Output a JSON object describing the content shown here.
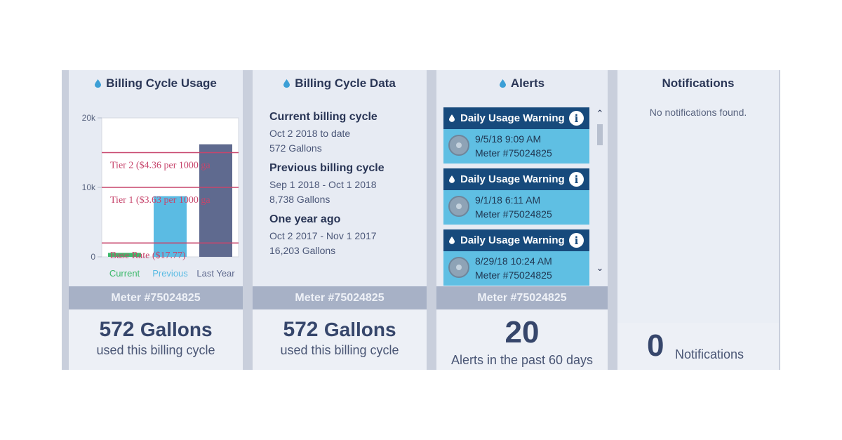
{
  "usage_panel": {
    "title": "Billing Cycle Usage",
    "meter_label": "Meter #75024825",
    "gallons_value": "572",
    "gallons_unit": "Gallons",
    "gallons_caption": "used this billing cycle"
  },
  "chart_data": {
    "type": "bar",
    "categories": [
      "Current",
      "Previous",
      "Last Year"
    ],
    "values": [
      572,
      8738,
      16203
    ],
    "category_colors": [
      "#3cb96a",
      "#5bbbe3",
      "#5f6a8f"
    ],
    "ylim": [
      0,
      20000
    ],
    "ytick_labels": [
      "20k",
      "10k",
      "0"
    ],
    "ytick_values": [
      20000,
      10000,
      0
    ],
    "rate_lines": [
      {
        "label": "Tier 2 ($4.36 per 1000 ga",
        "value": 15000
      },
      {
        "label": "Tier 1 ($3.63 per 1000 ga",
        "value": 10000
      },
      {
        "label": "Base Rate ($17.77)",
        "value": 2000
      }
    ],
    "rate_color": "#c7456c"
  },
  "data_panel": {
    "title": "Billing Cycle Data",
    "blocks": [
      {
        "heading": "Current billing cycle",
        "dates": "Oct 2 2018 to date",
        "gallons": "572 Gallons"
      },
      {
        "heading": "Previous billing cycle",
        "dates": "Sep 1 2018 - Oct 1 2018",
        "gallons": "8,738 Gallons"
      },
      {
        "heading": "One year ago",
        "dates": "Oct 2 2017 - Nov 1 2017",
        "gallons": "16,203 Gallons"
      }
    ],
    "meter_label": "Meter #75024825",
    "gallons_value": "572",
    "gallons_unit": "Gallons",
    "gallons_caption": "used this billing cycle"
  },
  "alerts_panel": {
    "title": "Alerts",
    "items": [
      {
        "title": "Daily Usage Warning",
        "date": "9/5/18 9:09 AM",
        "meter": "Meter #75024825"
      },
      {
        "title": "Daily Usage Warning",
        "date": "9/1/18 6:11 AM",
        "meter": "Meter #75024825"
      },
      {
        "title": "Daily Usage Warning",
        "date": "8/29/18 10:24 AM",
        "meter": "Meter #75024825"
      }
    ],
    "meter_label": "Meter #75024825",
    "count": "20",
    "count_caption": "Alerts in the past 60 days"
  },
  "notifications_panel": {
    "title": "Notifications",
    "empty_message": "No notifications found.",
    "count": "0",
    "count_label": "Notifications"
  },
  "colors": {
    "accent_dark": "#174a7c",
    "alert_card": "#5fbfe3",
    "meter_bar": "#a7b1c6"
  }
}
